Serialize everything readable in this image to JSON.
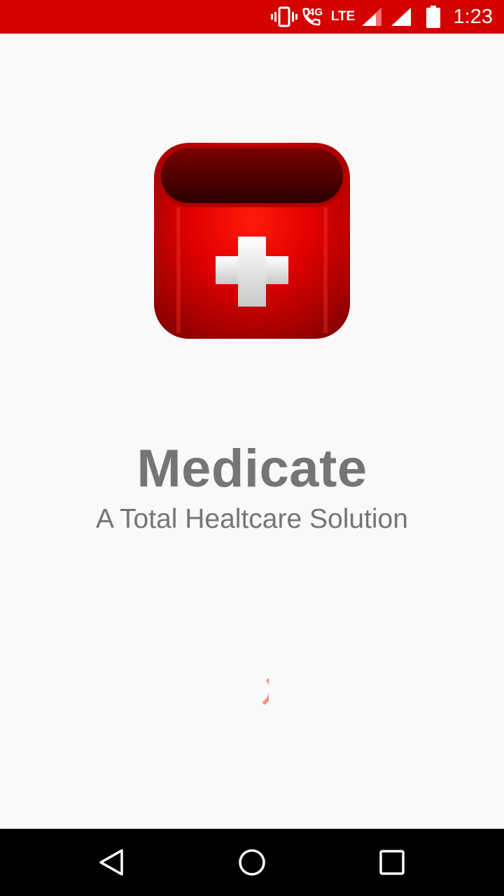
{
  "status_bar": {
    "time": "1:23",
    "network_label": "LTE",
    "network_sub": "4G",
    "icons": [
      "vibrate-icon",
      "wifi-call-icon",
      "signal-icon",
      "signal-full-icon",
      "battery-icon"
    ]
  },
  "app": {
    "title": "Medicate",
    "subtitle": "A Total Healtcare Solution"
  },
  "colors": {
    "status_bar": "#d50000",
    "text": "#757575",
    "spinner": "#ff8a80",
    "nav_bar": "#000000"
  },
  "nav_bar": {
    "buttons": [
      "back-icon",
      "home-icon",
      "recents-icon"
    ]
  }
}
